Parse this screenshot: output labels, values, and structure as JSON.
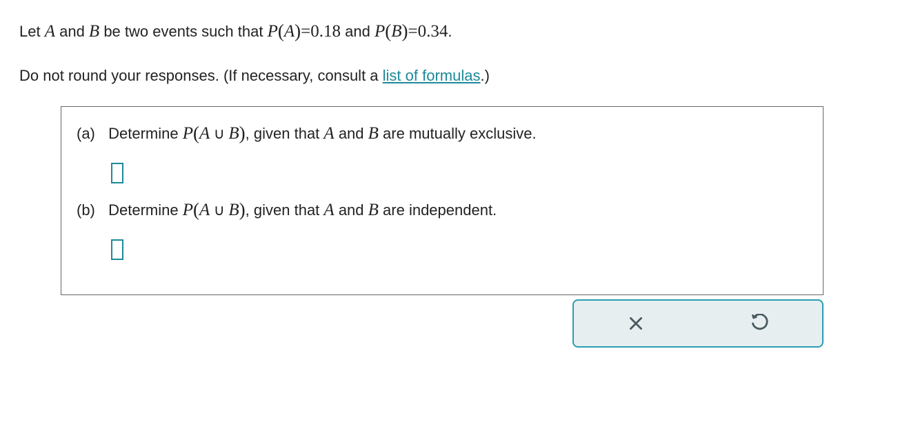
{
  "intro": {
    "let_prefix": "Let ",
    "A": "A",
    "and1": " and ",
    "B": "B",
    "suffix1": " be two events such that ",
    "P1": "P",
    "lp1": "(",
    "Aarg": "A",
    "rp1": ")",
    "eq1": "=",
    "val1": "0.18",
    "and2": " and ",
    "P2": "P",
    "lp2": "(",
    "Barg": "B",
    "rp2": ")",
    "eq2": "=",
    "val2": "0.34",
    "period": "."
  },
  "instruction": {
    "text1": "Do not round your responses. (If necessary, consult a ",
    "link": "list of formulas",
    "text2": ".)"
  },
  "parts": {
    "a": {
      "label": "(a)",
      "pre": "Determine ",
      "P": "P",
      "lp": "(",
      "A": "A",
      "cup": " ∪ ",
      "B": "B",
      "rp": ")",
      "post": ", given that ",
      "A2": "A",
      "and": " and ",
      "B2": "B",
      "tail": " are mutually exclusive."
    },
    "b": {
      "label": "(b)",
      "pre": "Determine ",
      "P": "P",
      "lp": "(",
      "A": "A",
      "cup": " ∪ ",
      "B": "B",
      "rp": ")",
      "post": ", given that ",
      "A2": "A",
      "and": " and ",
      "B2": "B",
      "tail": " are independent."
    }
  },
  "answers": {
    "a": "",
    "b": ""
  }
}
